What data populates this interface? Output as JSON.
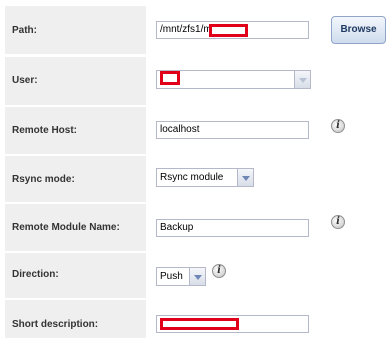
{
  "form": {
    "path": {
      "label": "Path:",
      "value": "/mnt/zfs1/m",
      "browse_label": "Browse"
    },
    "user": {
      "label": "User:",
      "value": ""
    },
    "remote_host": {
      "label": "Remote Host:",
      "value": "localhost",
      "info_icon": "i"
    },
    "rsync_mode": {
      "label": "Rsync mode:",
      "value": "Rsync module"
    },
    "remote_module_name": {
      "label": "Remote Module Name:",
      "value": "Backup",
      "info_icon": "i"
    },
    "direction": {
      "label": "Direction:",
      "value": "Push",
      "info_icon": "i"
    },
    "short_description": {
      "label": "Short description:",
      "value": ""
    }
  },
  "colors": {
    "label_background": "#efefef",
    "field_border": "#b5b8c8",
    "redaction": "#e0001a",
    "button_text": "#1f3a63"
  },
  "icons": {
    "info": "info-icon",
    "dropdown": "chevron-down-icon"
  }
}
